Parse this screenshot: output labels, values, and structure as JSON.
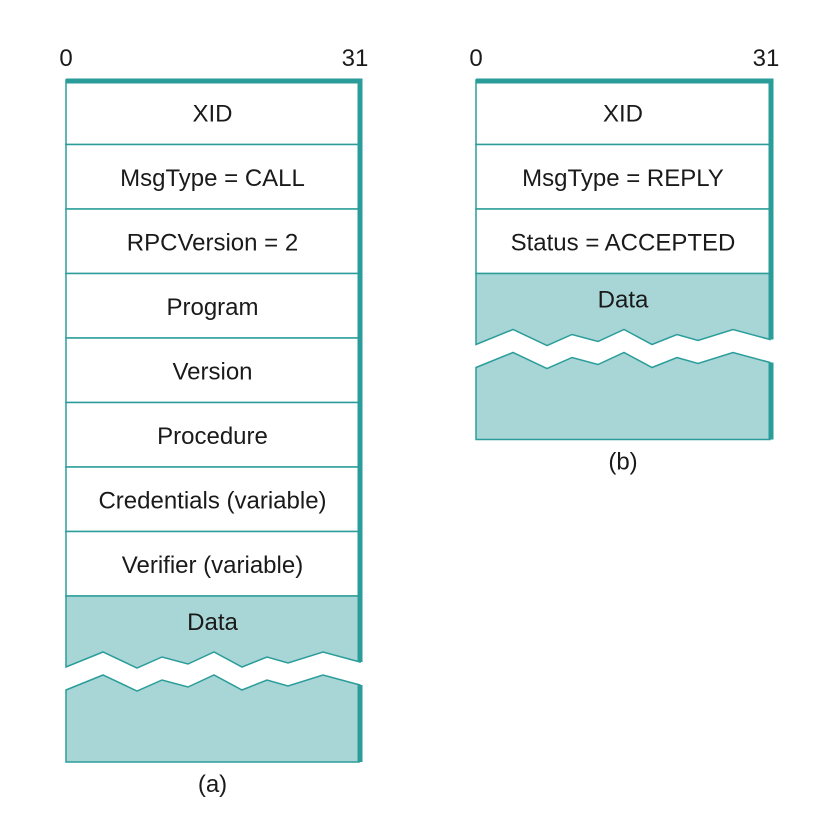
{
  "colors": {
    "stroke": "#2a9d9a",
    "data_fill": "#a8d5d5"
  },
  "call": {
    "bit_start": "0",
    "bit_end": "31",
    "fields": [
      "XID",
      "MsgType = CALL",
      "RPCVersion = 2",
      "Program",
      "Version",
      "Procedure",
      "Credentials (variable)",
      "Verifier (variable)"
    ],
    "data_label": "Data",
    "caption": "(a)"
  },
  "reply": {
    "bit_start": "0",
    "bit_end": "31",
    "fields": [
      "XID",
      "MsgType = REPLY",
      "Status = ACCEPTED"
    ],
    "data_label": "Data",
    "caption": "(b)"
  }
}
